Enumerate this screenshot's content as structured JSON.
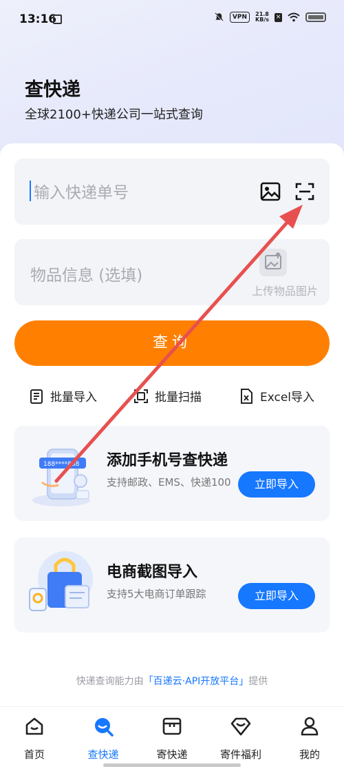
{
  "status_bar": {
    "time": "13:16",
    "vpn": "VPN",
    "speed_value": "21.8",
    "speed_unit": "KB/s"
  },
  "header": {
    "title": "查快递",
    "subtitle": "全球2100+快递公司一站式查询"
  },
  "tracking_input": {
    "placeholder": "输入快递单号"
  },
  "goods_input": {
    "placeholder": "物品信息 (选填)",
    "upload_label": "上传物品图片"
  },
  "query_button": "查询",
  "quick_actions": [
    {
      "label": "批量导入",
      "icon": "list-doc-icon"
    },
    {
      "label": "批量扫描",
      "icon": "scan-doc-icon"
    },
    {
      "label": "Excel导入",
      "icon": "excel-icon"
    }
  ],
  "promos": [
    {
      "title": "添加手机号查快递",
      "desc": "支持邮政、EMS、快递100",
      "button": "立即导入",
      "icon": "phone-card-illustration"
    },
    {
      "title": "电商截图导入",
      "desc": "支持5大电商订单跟踪",
      "button": "立即导入",
      "icon": "shopping-bag-illustration"
    }
  ],
  "footer": {
    "prefix": "快递查询能力由",
    "highlight": "「百递云·API开放平台」",
    "suffix": "提供"
  },
  "tabbar": [
    {
      "label": "首页",
      "icon": "home-icon",
      "active": false
    },
    {
      "label": "查快递",
      "icon": "search-express-icon",
      "active": true
    },
    {
      "label": "寄快递",
      "icon": "box-icon",
      "active": false
    },
    {
      "label": "寄件福利",
      "icon": "diamond-icon",
      "active": false
    },
    {
      "label": "我的",
      "icon": "user-icon",
      "active": false
    }
  ],
  "colors": {
    "accent": "#1677ff",
    "query_button": "#ff8000",
    "annotation_arrow": "#e8504f"
  }
}
